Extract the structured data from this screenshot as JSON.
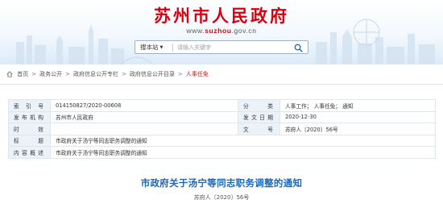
{
  "header": {
    "title": "苏州市人民政府",
    "url_prefix": "www.",
    "url_highlight": "suzhou",
    "url_suffix": ".gov.cn",
    "colors": {
      "title": "#d7000f",
      "highlight": "#d7000f"
    }
  },
  "search": {
    "scope_label": "搜本站",
    "placeholder": "请输入关键字",
    "icon": "search-icon"
  },
  "breadcrumb": {
    "icon": "home-icon",
    "items": [
      {
        "label": "首页"
      },
      {
        "label": "政务公开"
      },
      {
        "label": "政府信息公开专栏"
      },
      {
        "label": "政府信息公开目录"
      },
      {
        "label": "人事任免"
      }
    ],
    "separator": ">"
  },
  "meta": {
    "rows": [
      {
        "k1": "索 引 号",
        "v1": "014150827/2020-00608",
        "k2": "分　　类",
        "v2": "人事工作； 人事任免； 通知"
      },
      {
        "k1": "发布机构",
        "v1": "苏州市人民政府",
        "k2": "发文日期",
        "v2": "2020-12-30"
      },
      {
        "k1": "时　　效",
        "v1": "",
        "k2": "文　　号",
        "v2": "苏府人〔2020〕56号"
      }
    ],
    "title_label": "标　　题",
    "title_value": "市政府关于汤宁等同志职务调整的通知",
    "desc_label": "内容概述",
    "desc_value": "市政府关于汤宁等同志职务调整的通知",
    "colors": {
      "key_bg": "#ecf2f9",
      "border": "#dfe6ee"
    }
  },
  "article": {
    "title": "市政府关于汤宁等同志职务调整的通知",
    "doc_number": "苏府人〔2020〕56号",
    "color": "#1c66b6"
  }
}
